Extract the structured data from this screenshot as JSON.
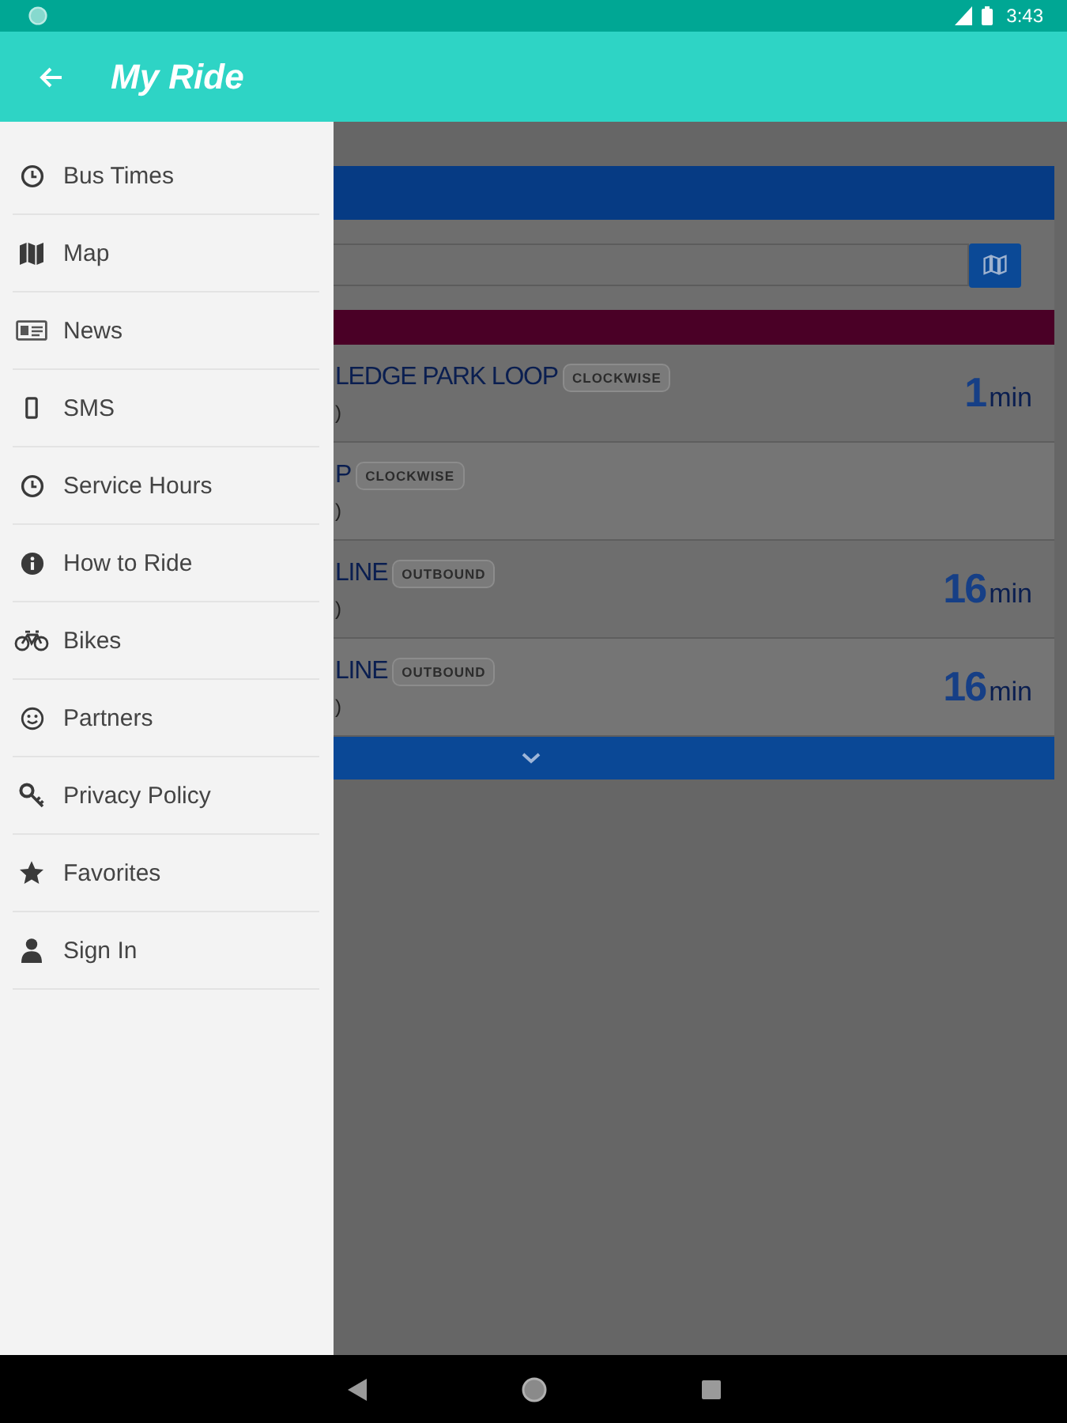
{
  "status_bar": {
    "time": "3:43"
  },
  "app_bar": {
    "title": "My Ride"
  },
  "drawer": {
    "items": [
      {
        "label": "Bus Times"
      },
      {
        "label": "Map"
      },
      {
        "label": "News"
      },
      {
        "label": "SMS"
      },
      {
        "label": "Service Hours"
      },
      {
        "label": "How to Ride"
      },
      {
        "label": "Bikes"
      },
      {
        "label": "Partners"
      },
      {
        "label": "Privacy Policy"
      },
      {
        "label": "Favorites"
      },
      {
        "label": "Sign In"
      }
    ]
  },
  "route_panel": {
    "rows": [
      {
        "name": "LEDGE PARK LOOP",
        "direction": "CLOCKWISE",
        "detail": ")",
        "minutes": "1",
        "unit": "min"
      },
      {
        "name": "P",
        "direction": "CLOCKWISE",
        "detail": ")"
      },
      {
        "name": "LINE",
        "direction": "OUTBOUND",
        "detail": ")",
        "minutes": "16",
        "unit": "min"
      },
      {
        "name": "LINE",
        "direction": "OUTBOUND",
        "detail": ")",
        "minutes": "16",
        "unit": "min"
      }
    ]
  }
}
